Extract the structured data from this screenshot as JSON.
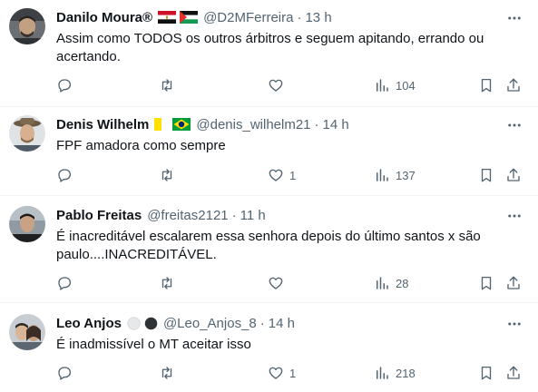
{
  "tweets": [
    {
      "name": "Danilo Moura®",
      "badges": [
        "egypt-flag",
        "palestine-flag"
      ],
      "handle": "@D2MFerreira",
      "separator": "·",
      "time": "13 h",
      "text": "Assim como TODOS os outros árbitros e seguem apitando, errando ou acertando.",
      "views": "104",
      "likes": ""
    },
    {
      "name": "Denis Wilhelm",
      "badges": [
        "vatican-flag",
        "brazil-flag"
      ],
      "handle": "@denis_wilhelm21",
      "separator": "·",
      "time": "14 h",
      "text": "FPF amadora como sempre",
      "views": "137",
      "likes": "1"
    },
    {
      "name": "Pablo Freitas",
      "badges": [],
      "handle": "@freitas2121",
      "separator": "·",
      "time": "11 h",
      "text": "É inacreditável escalarem essa senhora depois do último santos x são paulo....INACREDITÁVEL.",
      "views": "28",
      "likes": ""
    },
    {
      "name": "Leo Anjos",
      "badges": [
        "white-circle",
        "black-circle"
      ],
      "handle": "@Leo_Anjos_8",
      "separator": "·",
      "time": "14 h",
      "text": "É inadmissível o MT aceitar isso",
      "views": "218",
      "likes": "1"
    }
  ]
}
